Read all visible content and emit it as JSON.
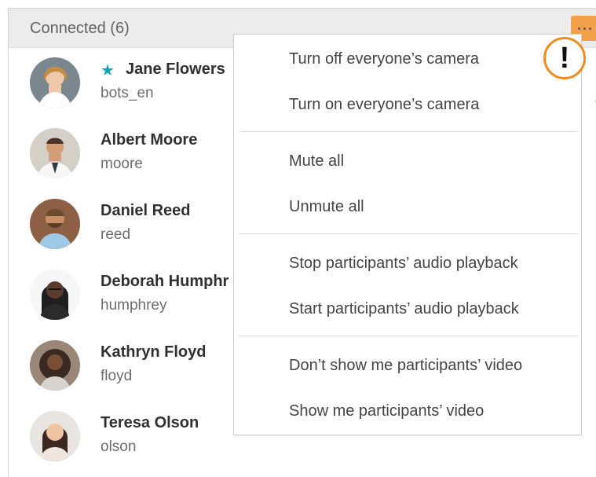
{
  "header": {
    "title": "Connected (6)"
  },
  "menu": {
    "items": [
      "Turn off everyone’s camera",
      "Turn on everyone’s camera",
      "Mute all",
      "Unmute all",
      "Stop participants’ audio playback",
      "Start participants’ audio playback",
      "Don’t show me participants’ video",
      "Show me participants’ video"
    ]
  },
  "participants": [
    {
      "name": "Jane Flowers",
      "username": "bots_en",
      "starred": true
    },
    {
      "name": "Albert Moore",
      "username": "moore"
    },
    {
      "name": "Daniel Reed",
      "username": "reed"
    },
    {
      "name": "Deborah Humphr",
      "username": "humphrey"
    },
    {
      "name": "Kathryn Floyd",
      "username": "floyd"
    },
    {
      "name": "Teresa Olson",
      "username": "olson"
    }
  ],
  "badge": {
    "text": "!"
  },
  "colors": {
    "accent": "#f3a04b",
    "warning": "#f08c22",
    "star": "#18a2b8"
  },
  "icons": {
    "star": "star-icon",
    "more": "more-horizontal-icon",
    "mic": "microphone-off-icon"
  }
}
